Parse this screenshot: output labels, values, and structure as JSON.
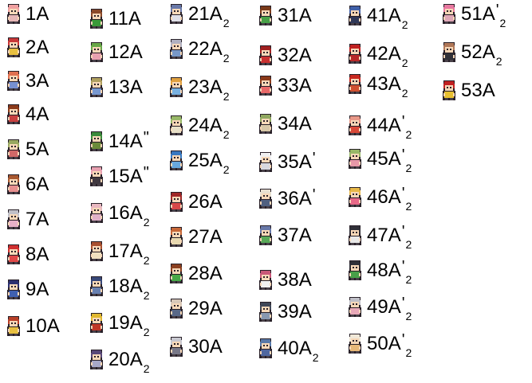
{
  "entries": [
    {
      "num": "1",
      "letter": "A",
      "mark": "",
      "sub": "",
      "hair": "#f0a0a0",
      "shirt": "#e8b8b8",
      "skin": "#f8d8b8"
    },
    {
      "num": "2",
      "letter": "A",
      "mark": "",
      "sub": "",
      "hair": "#c83838",
      "shirt": "#e8c040",
      "skin": "#f8d8b8"
    },
    {
      "num": "3",
      "letter": "A",
      "mark": "",
      "sub": "",
      "hair": "#e07050",
      "shirt": "#7890d0",
      "skin": "#f8d8b8"
    },
    {
      "num": "4",
      "letter": "A",
      "mark": "",
      "sub": "",
      "hair": "#8b3a1a",
      "shirt": "#c84040",
      "skin": "#f8d8b8"
    },
    {
      "num": "5",
      "letter": "A",
      "mark": "",
      "sub": "",
      "hair": "#98a860",
      "shirt": "#d06868",
      "skin": "#f8d8b8"
    },
    {
      "num": "6",
      "letter": "A",
      "mark": "",
      "sub": "",
      "hair": "#a85830",
      "shirt": "#e89090",
      "skin": "#f8d8b8"
    },
    {
      "num": "7",
      "letter": "A",
      "mark": "",
      "sub": "",
      "hair": "#c0c0c8",
      "shirt": "#e8b0c8",
      "skin": "#f8d8b8"
    },
    {
      "num": "8",
      "letter": "A",
      "mark": "",
      "sub": "",
      "hair": "#d03030",
      "shirt": "#e04848",
      "skin": "#f8d8b8"
    },
    {
      "num": "9",
      "letter": "A",
      "mark": "",
      "sub": "",
      "hair": "#2c3070",
      "shirt": "#4060b0",
      "skin": "#f8d8b8"
    },
    {
      "num": "10",
      "letter": "A",
      "mark": "",
      "sub": "",
      "hair": "#b84028",
      "shirt": "#e8c040",
      "skin": "#f8d8b8"
    },
    {
      "num": "11",
      "letter": "A",
      "mark": "",
      "sub": "",
      "hair": "#8b4a2a",
      "shirt": "#3a9a3a",
      "skin": "#f8d8b8"
    },
    {
      "num": "12",
      "letter": "A",
      "mark": "",
      "sub": "",
      "hair": "#68a848",
      "shirt": "#e8a0b0",
      "skin": "#f8d8b8"
    },
    {
      "num": "13",
      "letter": "A",
      "mark": "",
      "sub": "",
      "hair": "#b0a060",
      "shirt": "#7898d0",
      "skin": "#f8d8b8"
    },
    {
      "num": "14",
      "letter": "A",
      "mark": "\"",
      "sub": "",
      "hair": "#3a8a3a",
      "shirt": "#6a8a3a",
      "skin": "#f8d8b8"
    },
    {
      "num": "15",
      "letter": "A",
      "mark": "\"",
      "sub": "",
      "hair": "#e8a0b0",
      "shirt": "#403840",
      "skin": "#f8d8b8"
    },
    {
      "num": "16",
      "letter": "A",
      "mark": "",
      "sub": "2",
      "hair": "#e8b8c0",
      "shirt": "#e0b0c8",
      "skin": "#f8d8b8"
    },
    {
      "num": "17",
      "letter": "A",
      "mark": "",
      "sub": "2",
      "hair": "#a85030",
      "shirt": "#f0e0c0",
      "skin": "#f8d8b8"
    },
    {
      "num": "18",
      "letter": "A",
      "mark": "",
      "sub": "2",
      "hair": "#384878",
      "shirt": "#6880b0",
      "skin": "#f8d8b8"
    },
    {
      "num": "19",
      "letter": "A",
      "mark": "",
      "sub": "2",
      "hair": "#e0b830",
      "shirt": "#c03828",
      "skin": "#f8d8b8"
    },
    {
      "num": "20",
      "letter": "A",
      "mark": "",
      "sub": "2",
      "hair": "#584878",
      "shirt": "#a8a8c8",
      "skin": "#f8d8b8"
    },
    {
      "num": "21",
      "letter": "A",
      "mark": "",
      "sub": "2",
      "hair": "#6878a8",
      "shirt": "#e0e0e8",
      "skin": "#f8d8b8"
    },
    {
      "num": "22",
      "letter": "A",
      "mark": "",
      "sub": "2",
      "hair": "#b0b0c0",
      "shirt": "#7898c8",
      "skin": "#f8d8b8"
    },
    {
      "num": "23",
      "letter": "A",
      "mark": "",
      "sub": "2",
      "hair": "#e0a040",
      "shirt": "#78b0e0",
      "skin": "#f8d8b8"
    },
    {
      "num": "24",
      "letter": "A",
      "mark": "",
      "sub": "2",
      "hair": "#98b868",
      "shirt": "#e8e0c8",
      "skin": "#f8d8b8"
    },
    {
      "num": "25",
      "letter": "A",
      "mark": "",
      "sub": "2",
      "hair": "#3878c0",
      "shirt": "#68a8e0",
      "skin": "#f8d8b8"
    },
    {
      "num": "26",
      "letter": "A",
      "mark": "",
      "sub": "",
      "hair": "#a02828",
      "shirt": "#d84848",
      "skin": "#f8d8b8"
    },
    {
      "num": "27",
      "letter": "A",
      "mark": "",
      "sub": "",
      "hair": "#c86838",
      "shirt": "#e8d8b0",
      "skin": "#f8d8b8"
    },
    {
      "num": "28",
      "letter": "A",
      "mark": "",
      "sub": "",
      "hair": "#8b4020",
      "shirt": "#48a848",
      "skin": "#f8d8b8"
    },
    {
      "num": "29",
      "letter": "A",
      "mark": "",
      "sub": "",
      "hair": "#d8c8b8",
      "shirt": "#586888",
      "skin": "#f8d8b8"
    },
    {
      "num": "30",
      "letter": "A",
      "mark": "",
      "sub": "",
      "hair": "#c8c8d0",
      "shirt": "#787888",
      "skin": "#f8d8b8"
    },
    {
      "num": "31",
      "letter": "A",
      "mark": "",
      "sub": "",
      "hair": "#7a3a1a",
      "shirt": "#48a048",
      "skin": "#f8d8b8"
    },
    {
      "num": "32",
      "letter": "A",
      "mark": "",
      "sub": "",
      "hair": "#a02020",
      "shirt": "#c83030",
      "skin": "#f8d8b8"
    },
    {
      "num": "33",
      "letter": "A",
      "mark": "",
      "sub": "",
      "hair": "#8b3a1a",
      "shirt": "#e86868",
      "skin": "#f8d8b8"
    },
    {
      "num": "34",
      "letter": "A",
      "mark": "",
      "sub": "",
      "hair": "#90a860",
      "shirt": "#d8c8a8",
      "skin": "#f8d8b8"
    },
    {
      "num": "35",
      "letter": "A",
      "mark": "'",
      "sub": "",
      "hair": "#f0f0f0",
      "shirt": "#d8d8e0",
      "skin": "#f8d8b8"
    },
    {
      "num": "36",
      "letter": "A",
      "mark": "'",
      "sub": "",
      "hair": "#e8e0d0",
      "shirt": "#506080",
      "skin": "#f8d8b8"
    },
    {
      "num": "37",
      "letter": "A",
      "mark": "",
      "sub": "",
      "hair": "#6878a8",
      "shirt": "#58a858",
      "skin": "#f8d8b8"
    },
    {
      "num": "38",
      "letter": "A",
      "mark": "",
      "sub": "",
      "hair": "#c85878",
      "shirt": "#f0f0f0",
      "skin": "#f8d8b8"
    },
    {
      "num": "39",
      "letter": "A",
      "mark": "",
      "sub": "",
      "hair": "#404858",
      "shirt": "#8898b0",
      "skin": "#f8d8b8"
    },
    {
      "num": "40",
      "letter": "A",
      "mark": "",
      "sub": "2",
      "hair": "#5878a8",
      "shirt": "#5068a0",
      "skin": "#f8d8b8"
    },
    {
      "num": "41",
      "letter": "A",
      "mark": "",
      "sub": "2",
      "hair": "#4060a8",
      "shirt": "#303858",
      "skin": "#f8d8b8"
    },
    {
      "num": "42",
      "letter": "A",
      "mark": "",
      "sub": "2",
      "hair": "#c02020",
      "shirt": "#b82828",
      "skin": "#f8d8b8"
    },
    {
      "num": "43",
      "letter": "A",
      "mark": "",
      "sub": "2",
      "hair": "#c82820",
      "shirt": "#d05030",
      "skin": "#f8d8b8"
    },
    {
      "num": "44",
      "letter": "A",
      "mark": "'",
      "sub": "2",
      "hair": "#e89888",
      "shirt": "#d84838",
      "skin": "#f8d8b8"
    },
    {
      "num": "45",
      "letter": "A",
      "mark": "'",
      "sub": "2",
      "hair": "#98b868",
      "shirt": "#e898a8",
      "skin": "#f8d8b8"
    },
    {
      "num": "46",
      "letter": "A",
      "mark": "'",
      "sub": "2",
      "hair": "#e8b848",
      "shirt": "#e86888",
      "skin": "#f8d8b8"
    },
    {
      "num": "47",
      "letter": "A",
      "mark": "'",
      "sub": "2",
      "hair": "#303038",
      "shirt": "#e8e8e8",
      "skin": "#f8d8b8"
    },
    {
      "num": "48",
      "letter": "A",
      "mark": "'",
      "sub": "2",
      "hair": "#303038",
      "shirt": "#48a048",
      "skin": "#f8d8b8"
    },
    {
      "num": "49",
      "letter": "A",
      "mark": "'",
      "sub": "2",
      "hair": "#c0c0c8",
      "shirt": "#e8a8b8",
      "skin": "#f8d8b8"
    },
    {
      "num": "50",
      "letter": "A",
      "mark": "'",
      "sub": "2",
      "hair": "#f0e8d8",
      "shirt": "#e8b878",
      "skin": "#f8d8b8"
    },
    {
      "num": "51",
      "letter": "A",
      "mark": "'",
      "sub": "2",
      "hair": "#e878a0",
      "shirt": "#e0a8b8",
      "skin": "#f8d8b8"
    },
    {
      "num": "52",
      "letter": "A",
      "mark": "",
      "sub": "2",
      "hair": "#b07858",
      "shirt": "#303038",
      "skin": "#f8d8b8"
    },
    {
      "num": "53",
      "letter": "A",
      "mark": "",
      "sub": "",
      "hair": "#c02020",
      "shirt": "#e8c030",
      "skin": "#f8d8b8"
    }
  ]
}
